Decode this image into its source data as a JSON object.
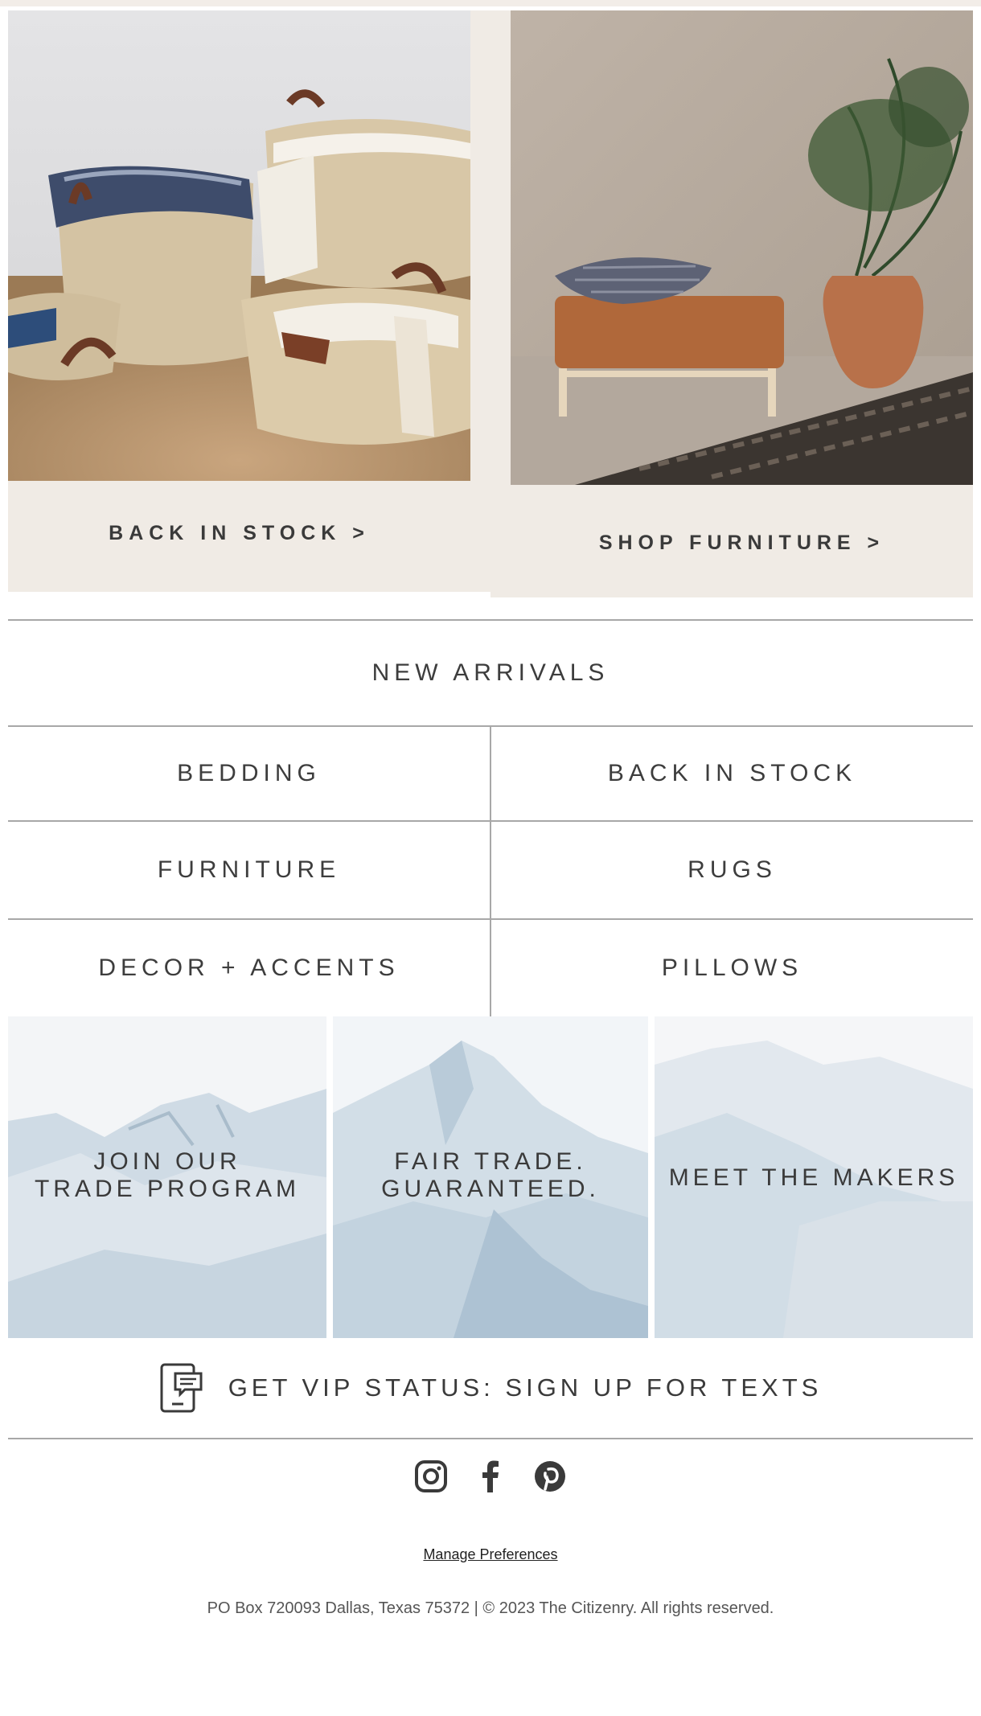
{
  "hero": {
    "left_label": "BACK IN STOCK >",
    "right_label": "SHOP FURNITURE >"
  },
  "categories": {
    "new_arrivals": "NEW ARRIVALS",
    "bedding": "BEDDING",
    "back_in_stock": "BACK IN STOCK",
    "furniture": "FURNITURE",
    "rugs": "RUGS",
    "decor_accents": "DECOR + ACCENTS",
    "pillows": "PILLOWS"
  },
  "tiles": {
    "trade_line1": "JOIN OUR",
    "trade_line2": "TRADE PROGRAM",
    "fair_line1": "FAIR TRADE.",
    "fair_line2": "GUARANTEED.",
    "makers": "MEET THE MAKERS"
  },
  "vip": {
    "text": "GET VIP STATUS: SIGN UP FOR TEXTS",
    "icon": "phone-chat-icon"
  },
  "social": {
    "icons": [
      "instagram-icon",
      "facebook-icon",
      "pinterest-icon"
    ]
  },
  "footer": {
    "manage_preferences": "Manage Preferences",
    "address": "PO Box 720093 Dallas, Texas 75372 | © 2023 The Citizenry. All rights reserved."
  },
  "colors": {
    "promo_bg": "#f0ebe5",
    "text_dark": "#3d3d3d",
    "divider": "#a8a8a8"
  }
}
